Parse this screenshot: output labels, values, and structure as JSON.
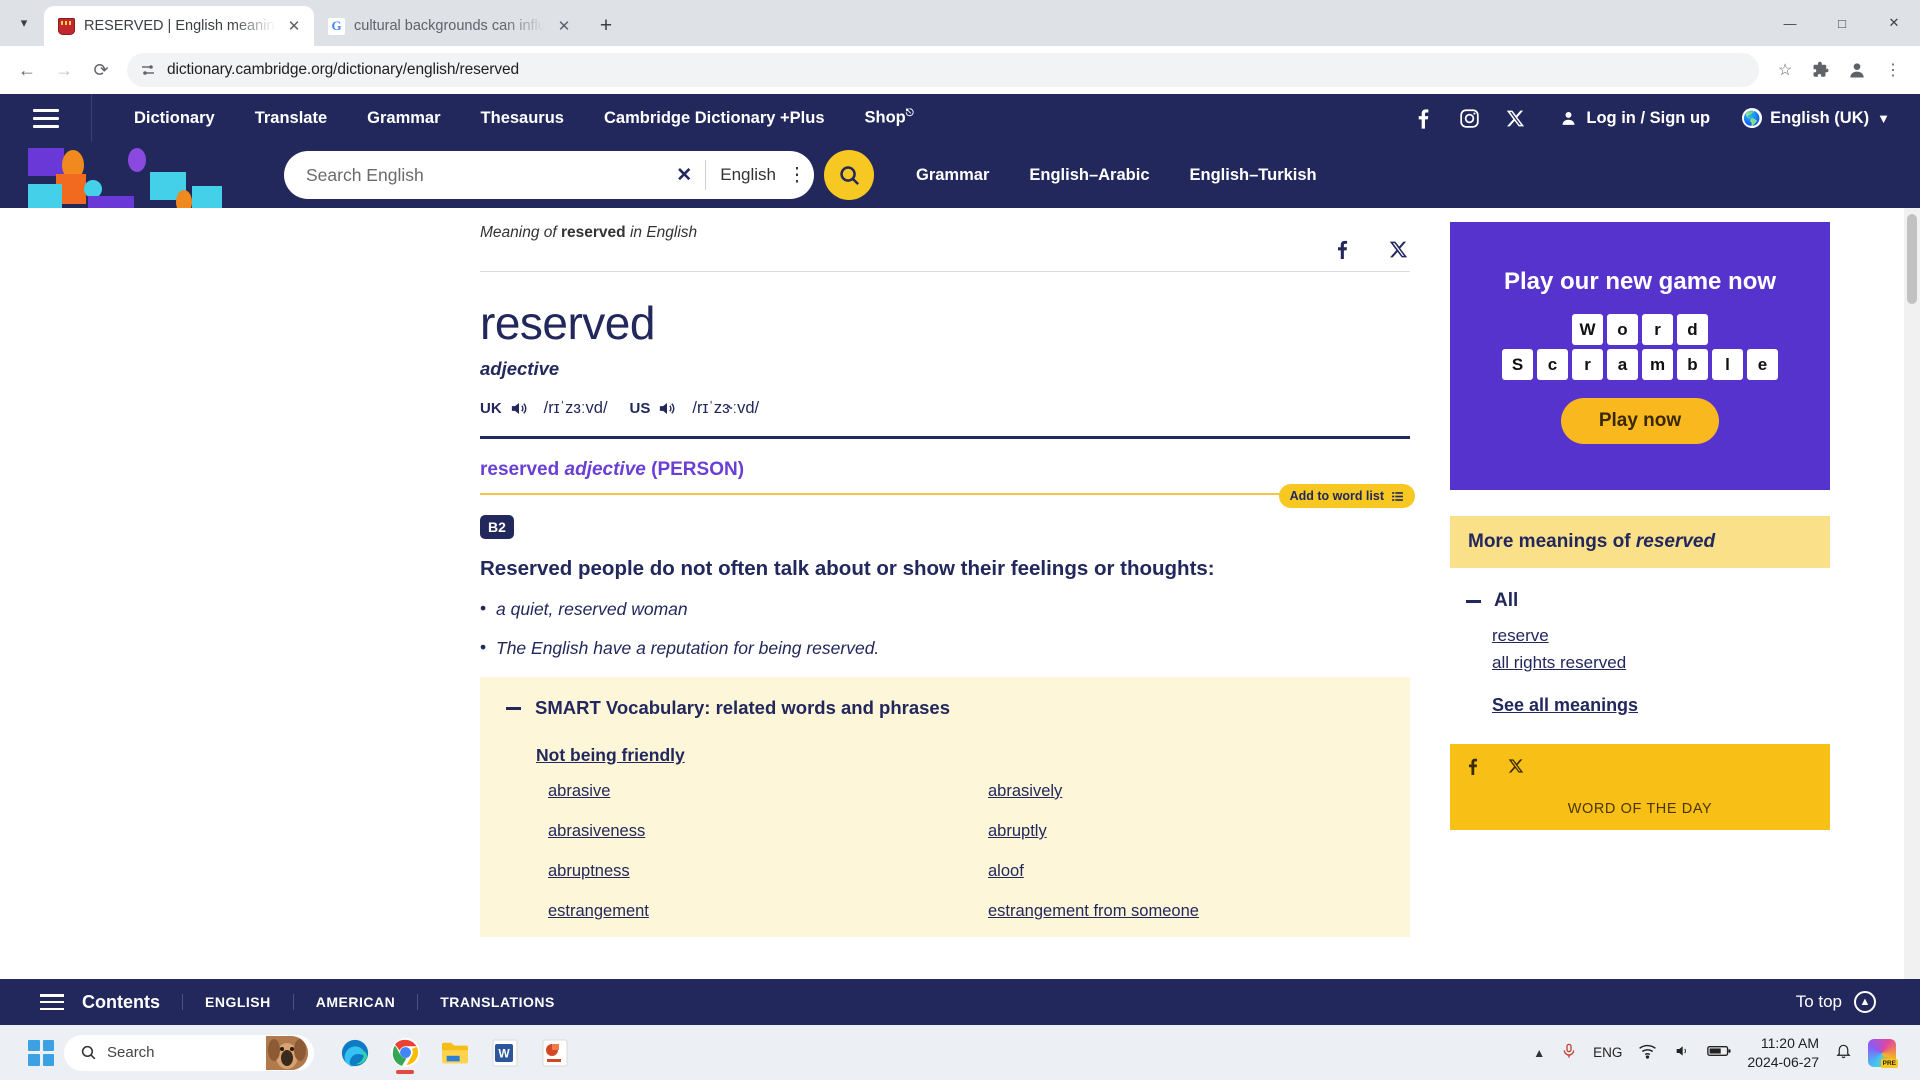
{
  "browser": {
    "tabs": [
      {
        "title": "RESERVED | English meaning -",
        "favicon": "cambridge-crest-icon",
        "active": true
      },
      {
        "title": "cultural backgrounds can influe",
        "favicon": "google-icon",
        "active": false
      }
    ],
    "new_tab_label": "+",
    "window_controls": {
      "minimize": "—",
      "maximize": "□",
      "close": "✕"
    },
    "nav": {
      "back": "←",
      "forward": "→",
      "reload": "⟳"
    },
    "url": "dictionary.cambridge.org/dictionary/english/reserved",
    "omnibox_icons": {
      "site_info": "tune-icon",
      "bookmark": "star-icon",
      "extensions": "puzzle-icon",
      "profile": "account-icon",
      "menu": "three-dots-icon"
    }
  },
  "site": {
    "topnav": [
      {
        "label": "Dictionary"
      },
      {
        "label": "Translate"
      },
      {
        "label": "Grammar"
      },
      {
        "label": "Thesaurus"
      },
      {
        "label": "Cambridge Dictionary +Plus"
      },
      {
        "label": "Shop",
        "external": true
      }
    ],
    "social": [
      {
        "name": "facebook-icon",
        "glyph": "f"
      },
      {
        "name": "instagram-icon",
        "glyph": "▢"
      },
      {
        "name": "x-twitter-icon",
        "glyph": "✕"
      }
    ],
    "login_label": "Log in / Sign up",
    "language_label": "English (UK)",
    "search": {
      "placeholder": "Search English",
      "value": "",
      "clear_label": "✕",
      "language": "English",
      "more_label": "⋮",
      "button": "search-icon"
    },
    "search_links": [
      {
        "label": "Grammar"
      },
      {
        "label": "English–Arabic"
      },
      {
        "label": "English–Turkish"
      }
    ]
  },
  "entry": {
    "breadcrumb_prefix": "Meaning of ",
    "breadcrumb_word": "reserved",
    "breadcrumb_suffix": " in English",
    "headword": "reserved",
    "part_of_speech": "adjective",
    "pronunciations": [
      {
        "region": "UK",
        "ipa": "/rɪˈzɜːvd/"
      },
      {
        "region": "US",
        "ipa": "/rɪˈzɝːvd/"
      }
    ],
    "sense": {
      "word": "reserved",
      "pos": "adjective",
      "guideword": "(PERSON)",
      "level": "B2",
      "definition": "Reserved people do not often talk about or show their feelings or thoughts:",
      "examples": [
        "a quiet, reserved woman",
        "The English have a reputation for being reserved."
      ]
    },
    "add_to_word_list": "Add to word list",
    "smart_vocab": {
      "title": "SMART Vocabulary: related words and phrases",
      "subtitle": "Not being friendly",
      "left_column": [
        "abrasive",
        "abrasiveness",
        "abruptness",
        "estrangement"
      ],
      "right_column": [
        "abrasively",
        "abruptly",
        "aloof",
        "estrangement from someone"
      ]
    }
  },
  "sidebar": {
    "promo": {
      "title": "Play our new game now",
      "tiles_row1": [
        "W",
        "o",
        "r",
        "d"
      ],
      "tiles_row2": [
        "S",
        "c",
        "r",
        "a",
        "m",
        "b",
        "l",
        "e"
      ],
      "cta": "Play now"
    },
    "more_meanings": {
      "header_prefix": "More meanings of ",
      "header_word": "reserved",
      "group_label": "All",
      "links": [
        "reserve",
        "all rights reserved"
      ],
      "see_all": "See all meanings"
    },
    "word_of_the_day": {
      "title": "WORD OF THE DAY",
      "social": [
        {
          "name": "facebook-icon",
          "glyph": "f"
        },
        {
          "name": "x-twitter-icon",
          "glyph": "✕"
        }
      ]
    }
  },
  "bottom_bar": {
    "contents_label": "Contents",
    "tabs": [
      "ENGLISH",
      "AMERICAN",
      "TRANSLATIONS"
    ],
    "to_top_label": "To top"
  },
  "taskbar": {
    "start": "windows-start-icon",
    "search_placeholder": "Search",
    "apps": [
      {
        "name": "edge-icon",
        "active": false
      },
      {
        "name": "chrome-icon",
        "active": true
      },
      {
        "name": "file-explorer-icon",
        "active": false
      },
      {
        "name": "word-icon",
        "active": false
      },
      {
        "name": "powerpoint-icon",
        "active": false
      }
    ],
    "tray": {
      "overflow": "chevron-up-icon",
      "mic": "microphone-icon",
      "language": "ENG",
      "wifi": "wifi-icon",
      "volume": "volume-icon",
      "battery": "battery-icon",
      "time": "11:20 AM",
      "date": "2024-06-27",
      "notifications": "bell-icon",
      "copilot": "copilot-icon"
    }
  },
  "colors": {
    "cambridge_navy": "#22285c",
    "cambridge_yellow": "#f8c822",
    "purple_sense": "#6b3fd4",
    "smart_bg": "#fdf6d9",
    "promo_purple": "#5533cc"
  }
}
